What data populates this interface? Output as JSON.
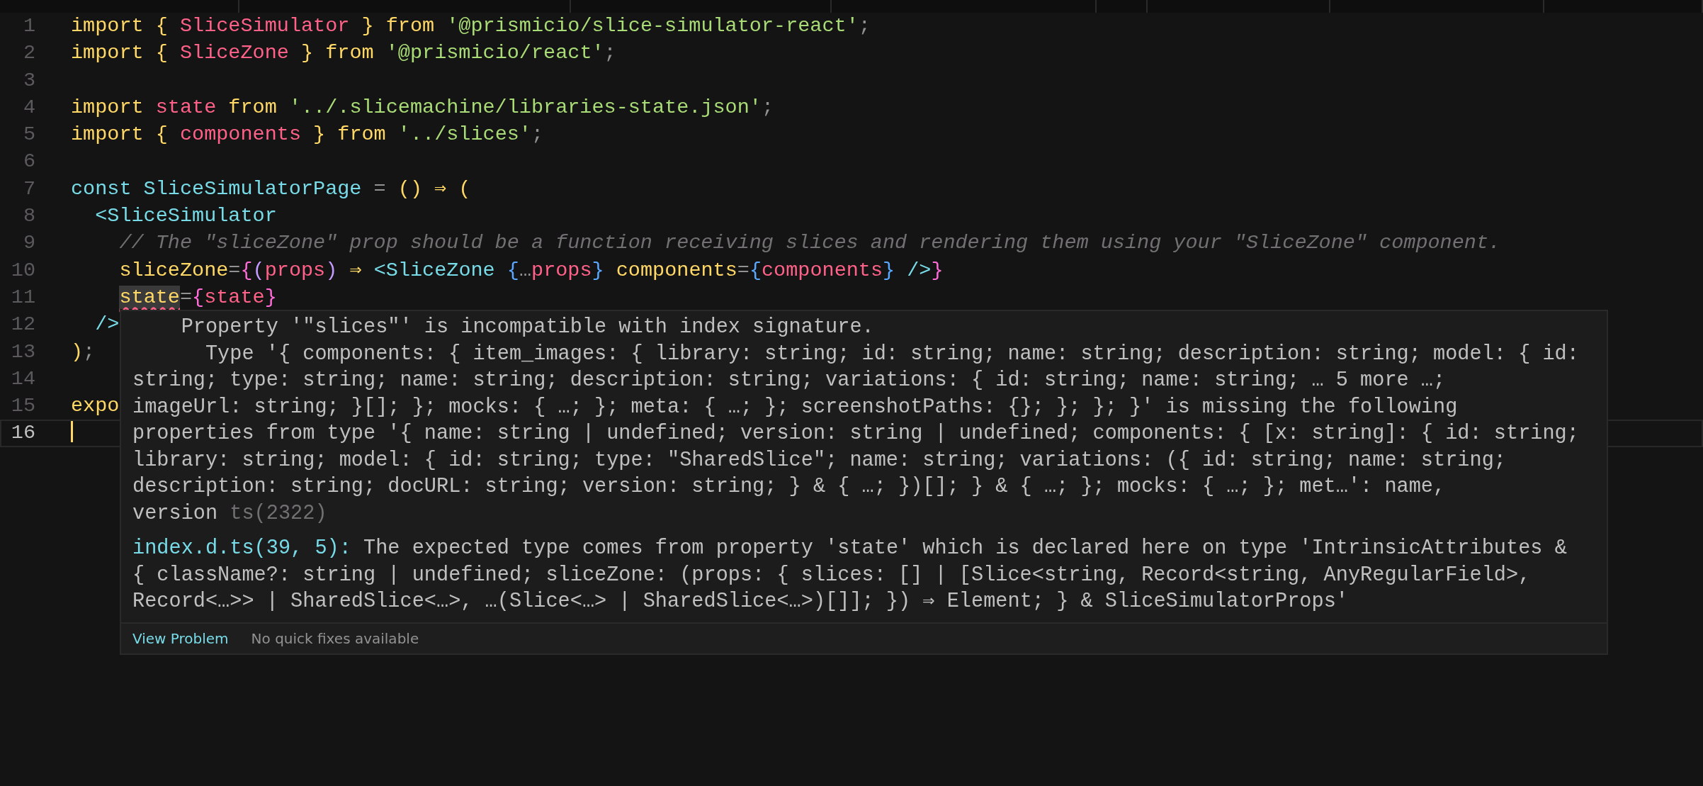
{
  "editor": {
    "lines": [
      {
        "number": "1",
        "current": false,
        "tokens": [
          {
            "kind": "keyword",
            "text": "import "
          },
          {
            "kind": "bracket",
            "text": "{ "
          },
          {
            "kind": "variable",
            "text": "SliceSimulator"
          },
          {
            "kind": "bracket",
            "text": " }"
          },
          {
            "kind": "keyword",
            "text": " from "
          },
          {
            "kind": "string",
            "text": "'@prismicio/slice-simulator-react'"
          },
          {
            "kind": "punct",
            "text": ";"
          }
        ]
      },
      {
        "number": "2",
        "current": false,
        "tokens": [
          {
            "kind": "keyword",
            "text": "import "
          },
          {
            "kind": "bracket",
            "text": "{ "
          },
          {
            "kind": "variable",
            "text": "SliceZone"
          },
          {
            "kind": "bracket",
            "text": " }"
          },
          {
            "kind": "keyword",
            "text": " from "
          },
          {
            "kind": "string",
            "text": "'@prismicio/react'"
          },
          {
            "kind": "punct",
            "text": ";"
          }
        ]
      },
      {
        "number": "3",
        "current": false
      },
      {
        "number": "4",
        "current": false,
        "tokens": [
          {
            "kind": "keyword",
            "text": "import "
          },
          {
            "kind": "variable",
            "text": "state"
          },
          {
            "kind": "keyword",
            "text": " from "
          },
          {
            "kind": "string",
            "text": "'../.slicemachine/libraries-state.json'"
          },
          {
            "kind": "punct",
            "text": ";"
          }
        ]
      },
      {
        "number": "5",
        "current": false,
        "tokens": [
          {
            "kind": "keyword",
            "text": "import "
          },
          {
            "kind": "bracket",
            "text": "{ "
          },
          {
            "kind": "variable",
            "text": "components"
          },
          {
            "kind": "bracket",
            "text": " }"
          },
          {
            "kind": "keyword",
            "text": " from "
          },
          {
            "kind": "string",
            "text": "'../slices'"
          },
          {
            "kind": "punct",
            "text": ";"
          }
        ]
      },
      {
        "number": "6",
        "current": false
      },
      {
        "number": "7",
        "current": false,
        "tokens": [
          {
            "kind": "type",
            "text": "const SliceSimulatorPage"
          },
          {
            "kind": "punct",
            "text": " = "
          },
          {
            "kind": "bracket",
            "text": "() ⇒ ("
          }
        ]
      },
      {
        "number": "8",
        "current": false,
        "tokens": [
          {
            "kind": "type",
            "text": "  <SliceSimulator"
          }
        ]
      },
      {
        "number": "9",
        "current": false,
        "tokens": [
          {
            "kind": "comment",
            "text": "    // The \"sliceZone\" prop should be a function receiving slices and rendering them using your \"SliceZone\" component."
          }
        ]
      },
      {
        "number": "10",
        "current": false,
        "tokens": [
          {
            "kind": "attr",
            "text": "    sliceZone"
          },
          {
            "kind": "punct",
            "text": "="
          },
          {
            "kind": "bracket2",
            "text": "{"
          },
          {
            "kind": "bracket3",
            "text": "("
          },
          {
            "kind": "variable",
            "text": "props"
          },
          {
            "kind": "bracket3",
            "text": ")"
          },
          {
            "kind": "bracket",
            "text": " ⇒ "
          },
          {
            "kind": "type",
            "text": "<SliceZone "
          },
          {
            "kind": "bracket4",
            "text": "{"
          },
          {
            "kind": "punct",
            "text": "…"
          },
          {
            "kind": "variable",
            "text": "props"
          },
          {
            "kind": "bracket4",
            "text": "}"
          },
          {
            "kind": "attr",
            "text": " components"
          },
          {
            "kind": "punct",
            "text": "="
          },
          {
            "kind": "bracket4",
            "text": "{"
          },
          {
            "kind": "variable",
            "text": "components"
          },
          {
            "kind": "bracket4",
            "text": "}"
          },
          {
            "kind": "type",
            "text": " />"
          },
          {
            "kind": "bracket2",
            "text": "}"
          }
        ]
      },
      {
        "number": "11",
        "current": false,
        "tokens": [
          {
            "kind": "error",
            "text": "    state"
          },
          {
            "kind": "punct",
            "text": "="
          },
          {
            "kind": "bracket2",
            "text": "{"
          },
          {
            "kind": "variable",
            "text": "state"
          },
          {
            "kind": "bracket2",
            "text": "}"
          }
        ]
      },
      {
        "number": "12",
        "current": false,
        "tokens": [
          {
            "kind": "type",
            "text": "  />"
          }
        ]
      },
      {
        "number": "13",
        "current": false,
        "tokens": [
          {
            "kind": "bracket",
            "text": ")"
          },
          {
            "kind": "punct",
            "text": ";"
          }
        ]
      },
      {
        "number": "14",
        "current": false
      },
      {
        "number": "15",
        "current": false,
        "tokens": [
          {
            "kind": "keyword",
            "text": "expo"
          }
        ]
      },
      {
        "number": "16",
        "current": true
      }
    ]
  },
  "hover": {
    "message_lines": [
      "    Property '\"slices\"' is incompatible with index signature.",
      "      Type '{ components: { item_images: { library: string; id: string; name: string; description: string; model: { id:",
      "string; type: string; name: string; description: string; variations: { id: string; name: string; … 5 more …;",
      "imageUrl: string; }[]; }; mocks: { …; }; meta: { …; }; screenshotPaths: {}; }; }; }' is missing the following",
      "properties from type '{ name: string | undefined; version: string | undefined; components: { [x: string]: { id: string;",
      "library: string; model: { id: string; type: \"SharedSlice\"; name: string; variations: ({ id: string; name: string;",
      "description: string; docURL: string; version: string; } & { …; })[]; } & { …; }; mocks: { …; }; met…': name,",
      "version"
    ],
    "code": "ts(2322)",
    "source": {
      "location": "index.d.ts(39, 5):",
      "lines": [
        "The expected type comes from property 'state' which is declared here on type 'IntrinsicAttributes &",
        "{ className?: string | undefined; sliceZone: (props: { slices: [] | [Slice<string, Record<string, AnyRegularField>,",
        "Record<…>> | SharedSlice<…>, …(Slice<…> | SharedSlice<…>)[]]; }) ⇒ Element; } & SliceSimulatorProps'"
      ]
    },
    "actions": [
      {
        "kind": "link",
        "label": "View Problem"
      },
      {
        "kind": "note",
        "label": "No quick fixes available"
      }
    ]
  }
}
